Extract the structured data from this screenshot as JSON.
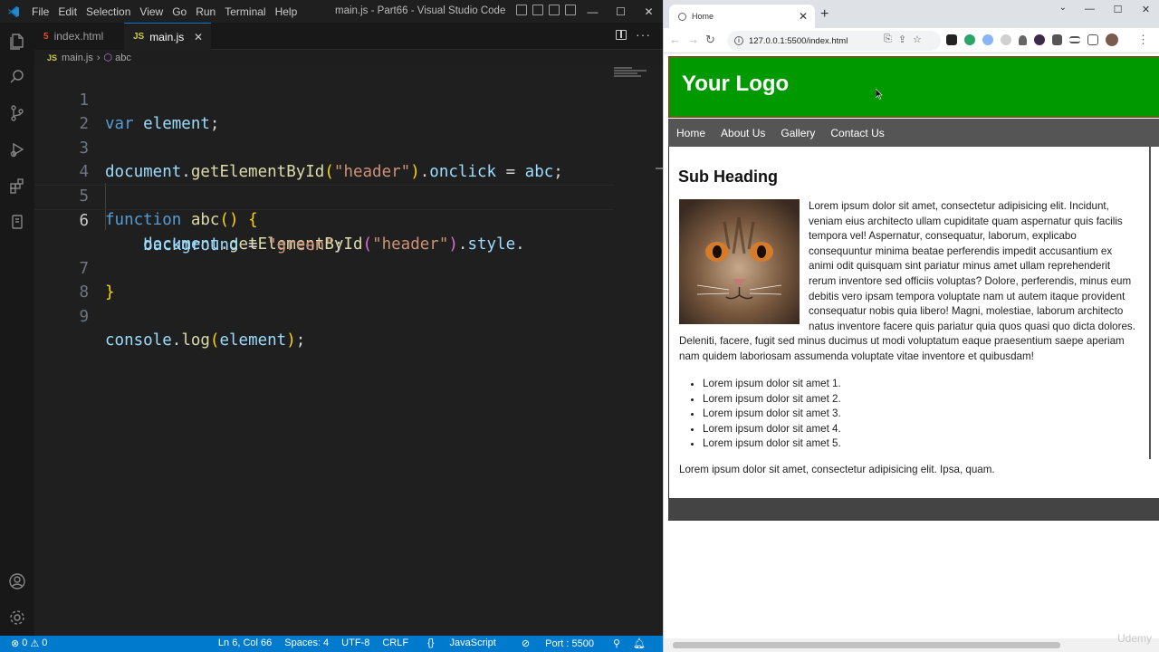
{
  "vscode": {
    "menu": [
      "File",
      "Edit",
      "Selection",
      "View",
      "Go",
      "Run",
      "Terminal",
      "Help"
    ],
    "window_title": "main.js - Part66 - Visual Studio Code",
    "tabs": [
      {
        "icon": "5",
        "label": "index.html"
      },
      {
        "icon": "JS",
        "label": "main.js",
        "close": "✕"
      }
    ],
    "breadcrumb": {
      "file": "main.js",
      "symbol": "abc"
    },
    "code_lines": [
      {
        "num": "1"
      },
      {
        "num": "2"
      },
      {
        "num": "3"
      },
      {
        "num": "4"
      },
      {
        "num": "5"
      },
      {
        "num": "6"
      },
      {
        "num": "7"
      },
      {
        "num": "8"
      },
      {
        "num": "9"
      }
    ],
    "code": {
      "l1_kw": "var",
      "l1_id": "element",
      "l1_end": ";",
      "l3_obj": "document",
      "l3_fn": "getElementById",
      "l3_str": "\"header\"",
      "l3_prop": "onclick",
      "l3_eq": " = ",
      "l3_id": "abc",
      "l3_end": ";",
      "l5_kw": "function",
      "l5_fn": "abc",
      "l5_paren": "()",
      "l5_brace": "{",
      "l6_obj": "document",
      "l6_fn": "getElementById",
      "l6_str": "\"header\"",
      "l6_prop": "style",
      "l6b_prop": "background",
      "l6b_eq": " = ",
      "l6b_str": "\"green\"",
      "l6b_end": ";",
      "l7_brace": "}",
      "l9_obj": "console",
      "l9_fn": "log",
      "l9_id": "element",
      "l9_end": ";"
    },
    "status": {
      "errors": "0",
      "warnings": "0",
      "position": "Ln 6, Col 66",
      "spaces": "Spaces: 4",
      "encoding": "UTF-8",
      "eol": "CRLF",
      "language": "JavaScript",
      "port": "Port : 5500"
    }
  },
  "chrome": {
    "tab_title": "Home",
    "url": "127.0.0.1:5500/index.html"
  },
  "site": {
    "logo": "Your Logo",
    "nav": [
      "Home",
      "About Us",
      "Gallery",
      "Contact Us"
    ],
    "subheading": "Sub Heading",
    "paragraph": "Lorem ipsum dolor sit amet, consectetur adipisicing elit. Incidunt, veniam eius architecto ullam cupiditate quam aspernatur quis facilis tempora vel! Aspernatur, consequatur, laborum, explicabo consequuntur minima beatae perferendis impedit accusantium ex animi odit quisquam sint pariatur minus amet ullam reprehenderit rerum inventore sed officiis voluptas? Dolore, perferendis, minus eum debitis vero ipsam tempora voluptate nam ut autem itaque provident consequatur nobis quia libero! Magni, molestiae, laborum architecto natus inventore facere quis pariatur quia quos quasi quo dicta dolores. Deleniti, facere, fugit sed minus ducimus ut modi voluptatum eaque praesentium saepe aperiam nam quidem laboriosam assumenda voluptate vitae inventore et quibusdam!",
    "list": [
      "Lorem ipsum dolor sit amet 1.",
      "Lorem ipsum dolor sit amet 2.",
      "Lorem ipsum dolor sit amet 3.",
      "Lorem ipsum dolor sit amet 4.",
      "Lorem ipsum dolor sit amet 5."
    ],
    "footer_paragraph": "Lorem ipsum dolor sit amet, consectetur adipisicing elit. Ipsa, quam.",
    "header_color": "#009900"
  },
  "watermark": "Udemy"
}
